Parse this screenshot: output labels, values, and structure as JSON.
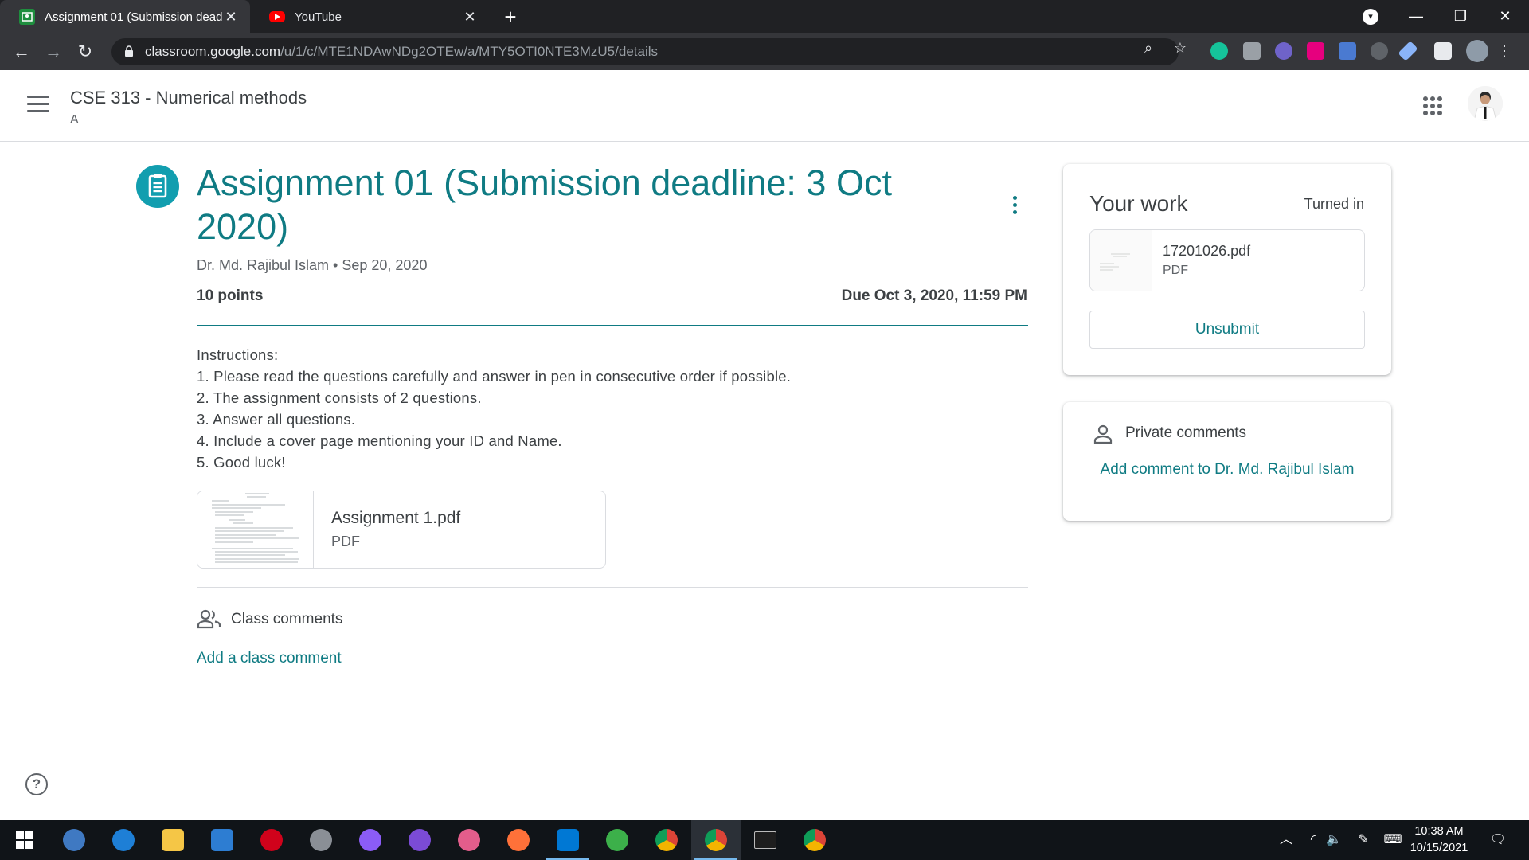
{
  "browser": {
    "tabs": [
      {
        "title": "Assignment 01 (Submission dead",
        "active": true
      },
      {
        "title": "YouTube",
        "active": false
      }
    ],
    "url_host": "classroom.google.com",
    "url_path": "/u/1/c/MTE1NDAwNDg2OTEw/a/MTY5OTI0NTE3MzU5/details"
  },
  "header": {
    "class_name": "CSE 313 - Numerical methods",
    "section": "A"
  },
  "assignment": {
    "title": "Assignment  01 (Submission deadline: 3 Oct 2020)",
    "teacher": "Dr. Md. Rajibul Islam",
    "date": "Sep 20, 2020",
    "points": "10 points",
    "due": "Due Oct 3, 2020, 11:59 PM",
    "instructions": [
      "Instructions:",
      "1. Please read the questions carefully and answer in pen in consecutive order if possible.",
      "2. The assignment consists of 2 questions.",
      "3. Answer all questions.",
      "4. Include a cover page mentioning your ID and Name.",
      "5. Good luck!"
    ],
    "attachment": {
      "name": "Assignment 1.pdf",
      "type": "PDF"
    }
  },
  "class_comments": {
    "label": "Class comments",
    "add": "Add a class comment"
  },
  "your_work": {
    "title": "Your work",
    "status": "Turned in",
    "file": {
      "name": "17201026.pdf",
      "type": "PDF"
    },
    "unsubmit_label": "Unsubmit"
  },
  "private_comments": {
    "label": "Private comments",
    "add": "Add comment to Dr. Md. Rajibul Islam"
  },
  "taskbar": {
    "time": "10:38 AM",
    "date": "10/15/2021"
  },
  "colors": {
    "accent": "#0f7b83",
    "icon_bg": "#129eaf",
    "chrome_dark": "#202124",
    "taskbar": "#101418"
  }
}
